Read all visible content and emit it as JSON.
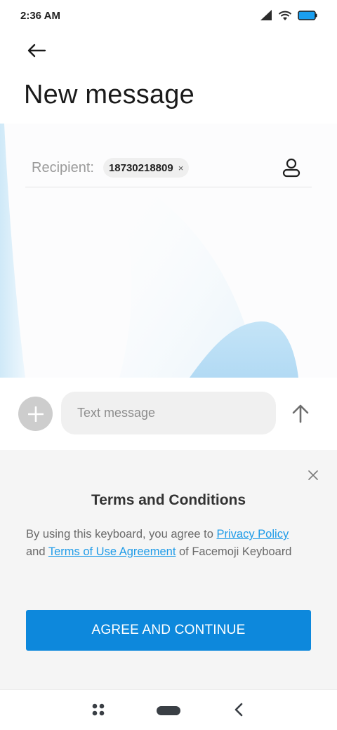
{
  "status_bar": {
    "time": "2:36 AM",
    "icons": [
      "signal-icon",
      "wifi-icon",
      "battery-icon"
    ]
  },
  "header": {
    "back_icon": "arrow-left-icon",
    "title": "New message"
  },
  "recipient": {
    "label": "Recipient:",
    "chip_value": "18730218809",
    "chip_remove": "×",
    "contact_icon": "person-icon"
  },
  "compose": {
    "attach_icon": "plus-icon",
    "placeholder": "Text message",
    "value": "",
    "send_icon": "arrow-up-icon"
  },
  "terms": {
    "title": "Terms and Conditions",
    "text_prefix": "By using this keyboard, you agree to ",
    "privacy_link": "Privacy Policy",
    "text_and": " and ",
    "terms_link": "Terms of Use Agreement",
    "text_suffix": " of Facemoji Keyboard",
    "agree_button": "AGREE AND CONTINUE",
    "close_icon": "close-icon"
  },
  "nav_bar": {
    "icons": [
      "recents-icon",
      "home-pill-icon",
      "back-chevron-icon"
    ]
  },
  "colors": {
    "accent": "#0d88dc",
    "link": "#1e9be8",
    "battery": "#1a9ff0",
    "decor": "#b9def5"
  }
}
